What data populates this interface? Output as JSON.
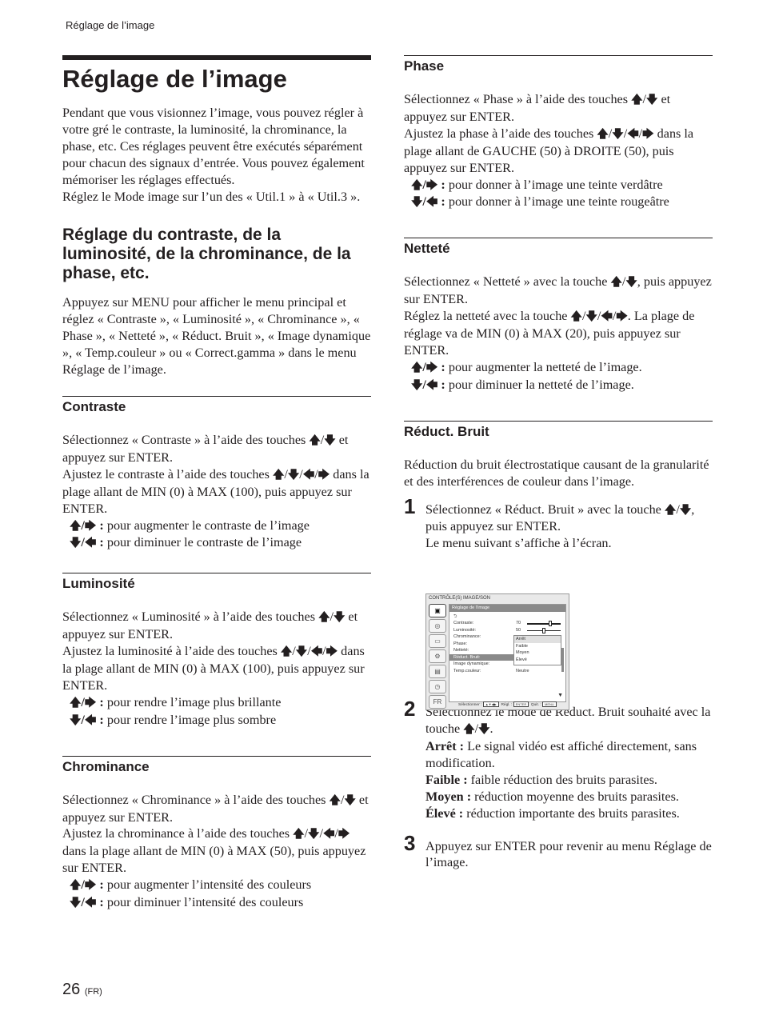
{
  "running_head": "Réglage de l’image",
  "page": {
    "number": "26",
    "lang": "(FR)"
  },
  "arrows": {
    "up": "🡅",
    "down": "🡇",
    "left": "🡄",
    "right": "🡆",
    "slash": "/"
  },
  "left": {
    "title": "Réglage de l’image",
    "intro": [
      "Pendant que vous visionnez l’image, vous pouvez régler à votre gré le contraste, la luminosité, la chrominance, la phase, etc. Ces réglages peuvent être exécutés séparément pour chacun des signaux d’entrée. Vous pouvez également mémoriser les réglages effectués.",
      "Réglez le Mode image sur l’un des « Util.1 » à « Util.3 »."
    ],
    "h2": "Réglage du contraste, de la luminosité, de la chrominance, de la phase, etc.",
    "h2_body": "Appuyez sur MENU pour afficher le menu principal et réglez « Contraste », « Luminosité », « Chrominance », « Phase », « Netteté », « Réduct. Bruit », « Image dynamique », « Temp.couleur » ou « Correct.gamma » dans le menu Réglage de l’image.",
    "contraste": {
      "heading": "Contraste",
      "p1a": "Sélectionnez « Contraste » à l’aide des touches ",
      "p1b": " et appuyez sur ENTER.",
      "p2a": "Ajustez le contraste à l’aide des touches ",
      "p2b": " dans la plage allant de MIN (0) à MAX (100), puis appuyez sur ENTER.",
      "inc": "pour augmenter le contraste de l’image",
      "dec": "pour diminuer le contraste de l’image"
    },
    "luminosite": {
      "heading": "Luminosité",
      "p1a": "Sélectionnez « Luminosité » à l’aide des touches ",
      "p1b": " et appuyez sur ENTER.",
      "p2a": "Ajustez la luminosité à l’aide des touches ",
      "p2b": " dans la plage allant de MIN (0) à MAX (100), puis appuyez sur ENTER.",
      "inc": "pour rendre l’image plus brillante",
      "dec": "pour rendre l’image plus sombre"
    },
    "chrominance": {
      "heading": "Chrominance",
      "p1a": "Sélectionnez « Chrominance » à l’aide des touches ",
      "p1b": " et appuyez sur ENTER.",
      "p2a": "Ajustez la chrominance à l’aide des touches ",
      "p2b": " dans la plage allant de MIN (0) à MAX (50), puis appuyez sur ENTER.",
      "inc": "pour augmenter l’intensité des couleurs",
      "dec": "pour diminuer l’intensité des couleurs"
    }
  },
  "right": {
    "phase": {
      "heading": "Phase",
      "p1a": "Sélectionnez « Phase » à l’aide des touches ",
      "p1b": " et appuyez sur ENTER.",
      "p2a": "Ajustez la phase à l’aide des touches ",
      "p2b": " dans la plage allant de GAUCHE (50) à DROITE (50), puis appuyez sur ENTER.",
      "inc": "pour donner à l’image une teinte verdâtre",
      "dec": "pour donner à l’image une teinte rougeâtre"
    },
    "nettete": {
      "heading": "Netteté",
      "p1a": "Sélectionnez « Netteté » avec la touche ",
      "p1b": ", puis appuyez sur ENTER.",
      "p2a": "Réglez la netteté avec la touche ",
      "p2b": ". La plage de réglage va de MIN (0) à MAX (20), puis appuyez sur ENTER.",
      "inc": "pour augmenter la netteté de l’image.",
      "dec": "pour diminuer la netteté de l’image."
    },
    "reduct": {
      "heading": "Réduct. Bruit",
      "intro": "Réduction du bruit électrostatique causant de la granularité et des interférences de couleur dans l’image.",
      "step1_num": "1",
      "step1a": "Sélectionnez « Réduct. Bruit » avec la touche ",
      "step1b": ", puis appuyez sur ENTER.",
      "step1c": "Le menu suivant s’affiche à l’écran.",
      "step2_num": "2",
      "step2a": "Sélectionnez le mode de Réduct. Bruit souhaité avec la touche ",
      "step2b": ".",
      "options": [
        {
          "term": "Arrêt :",
          "desc": "Le signal vidéo est affiché directement, sans modification."
        },
        {
          "term": "Faible :",
          "desc": "faible réduction des bruits parasites."
        },
        {
          "term": "Moyen :",
          "desc": "réduction moyenne des bruits parasites."
        },
        {
          "term": "Élevé :",
          "desc": "réduction importante des bruits parasites."
        }
      ],
      "step3_num": "3",
      "step3": "Appuyez sur ENTER pour revenir au menu Réglage de l’image."
    }
  },
  "osd": {
    "title": "CONTRÔLE(S) IMAGE/SON",
    "panel_title": "Réglage de l’image",
    "back": "⮌",
    "rows": [
      {
        "label": "Contraste:",
        "value": "70",
        "slider": 0.7
      },
      {
        "label": "Luminosité:",
        "value": "50",
        "slider": 0.5
      },
      {
        "label": "Chrominance:"
      },
      {
        "label": "Phase:"
      },
      {
        "label": "Netteté:"
      },
      {
        "label": "Réduct. Bruit:",
        "selected": true
      },
      {
        "label": "Image dynamique:",
        "value": "Arrêt"
      },
      {
        "label": "Temp.couleur:",
        "value": "Neutre"
      }
    ],
    "dropdown": [
      "Arrêt",
      "Faible",
      "Moyen",
      "Élevé"
    ],
    "dropdown_highlight": "Arrêt",
    "footer": {
      "select": "Sélectionner :",
      "set": "Régl. :",
      "set_key": "ENTER",
      "quit": "Quit. :",
      "quit_key": "MENU"
    }
  }
}
